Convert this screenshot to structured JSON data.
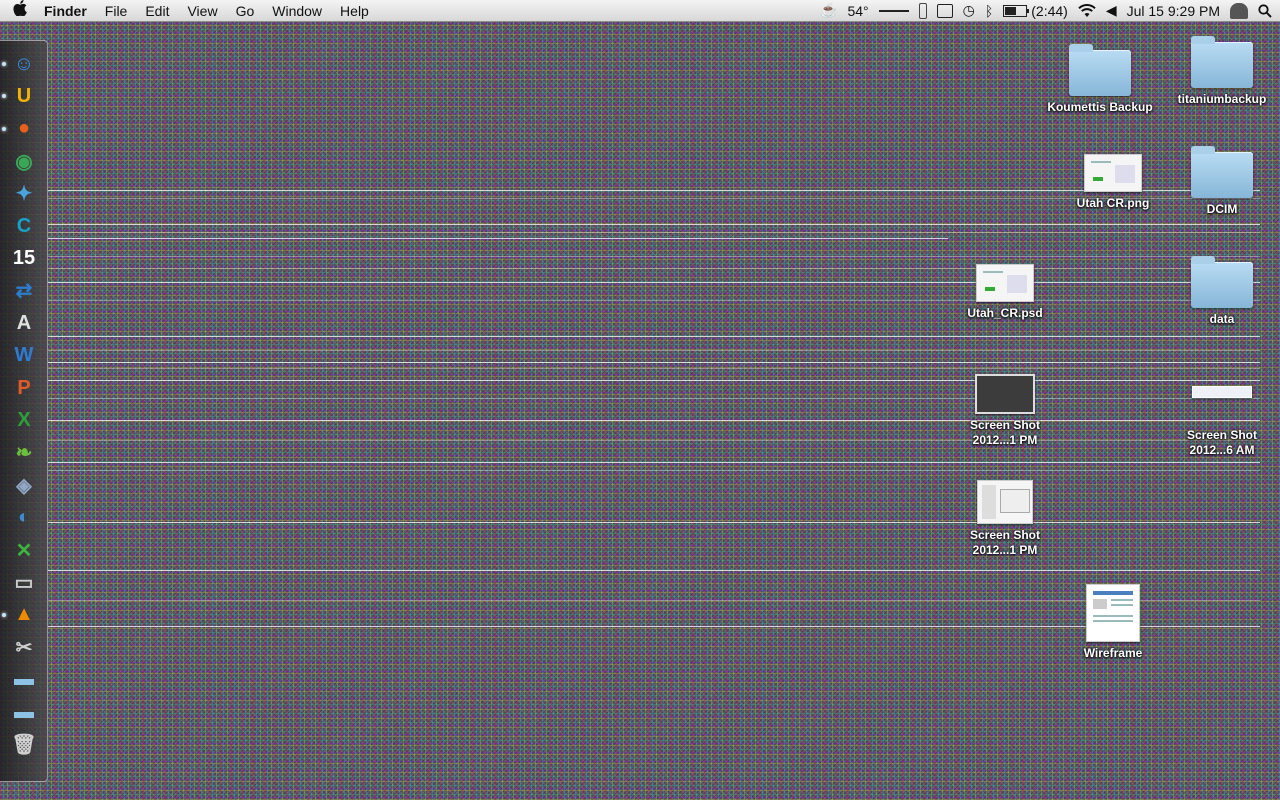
{
  "menubar": {
    "app_name": "Finder",
    "menus": [
      "File",
      "Edit",
      "View",
      "Go",
      "Window",
      "Help"
    ],
    "status": {
      "temperature": "54°",
      "battery": "(2:44)",
      "battery_level": 0.55,
      "datetime": "Jul 15  9:29 PM"
    },
    "icons": [
      "apple-icon",
      "dashboard-icon",
      "coffee-icon",
      "slider-icon",
      "display-icon",
      "time-machine-icon",
      "bluetooth-icon",
      "battery-icon",
      "wifi-icon",
      "volume-icon",
      "user-icon",
      "spotlight-icon"
    ]
  },
  "dock": {
    "items": [
      {
        "name": "finder",
        "glyph": "☺",
        "color": "#3a8ee6",
        "running": true
      },
      {
        "name": "magnet",
        "glyph": "U",
        "color": "#f2b400",
        "running": true
      },
      {
        "name": "firefox",
        "glyph": "●",
        "color": "#e8601c",
        "running": true
      },
      {
        "name": "chrome",
        "glyph": "◉",
        "color": "#3aa757",
        "running": false
      },
      {
        "name": "safari",
        "glyph": "✦",
        "color": "#4aa3df",
        "running": false
      },
      {
        "name": "cyberduck",
        "glyph": "C",
        "color": "#1aa0c8",
        "running": false
      },
      {
        "name": "calendar",
        "glyph": "15",
        "color": "#ffffff",
        "running": false
      },
      {
        "name": "sync",
        "glyph": "⇄",
        "color": "#2a7fd0",
        "running": false
      },
      {
        "name": "font-book",
        "glyph": "A",
        "color": "#e0e0e0",
        "running": false
      },
      {
        "name": "word",
        "glyph": "W",
        "color": "#2e7cd6",
        "running": false
      },
      {
        "name": "powerpoint",
        "glyph": "P",
        "color": "#e05a2a",
        "running": false
      },
      {
        "name": "excel",
        "glyph": "X",
        "color": "#2e9e3a",
        "running": false
      },
      {
        "name": "evernote",
        "glyph": "❧",
        "color": "#6abf3b",
        "running": false
      },
      {
        "name": "instruments",
        "glyph": "◈",
        "color": "#8fa7c4",
        "running": false
      },
      {
        "name": "network",
        "glyph": "◐",
        "color": "#3d8bd0",
        "running": false
      },
      {
        "name": "keepassx",
        "glyph": "✕",
        "color": "#3fb33f",
        "running": false
      },
      {
        "name": "terminal",
        "glyph": "▭",
        "color": "#cccccc",
        "running": false
      },
      {
        "name": "vlc",
        "glyph": "▲",
        "color": "#f08a00",
        "running": true
      },
      {
        "name": "utilities",
        "glyph": "✂",
        "color": "#cfcfcf",
        "running": false
      },
      {
        "name": "applications-stack",
        "glyph": "▬",
        "color": "#8ec1e6",
        "running": false
      },
      {
        "name": "documents-stack",
        "glyph": "▬",
        "color": "#8ec1e6",
        "running": false
      },
      {
        "name": "trash",
        "glyph": "🗑",
        "color": "#d0d0d0",
        "running": false
      }
    ]
  },
  "desktop": {
    "icons": [
      {
        "label": "Koumettis Backup",
        "kind": "folder"
      },
      {
        "label": "titaniumbackup",
        "kind": "folder"
      },
      {
        "label": "Utah CR.png",
        "kind": "image"
      },
      {
        "label": "DCIM",
        "kind": "folder"
      },
      {
        "label": "Utah_CR.psd",
        "kind": "image"
      },
      {
        "label": "data",
        "kind": "folder"
      },
      {
        "label": "Screen Shot 2012...1 PM",
        "kind": "screenshot-dark"
      },
      {
        "label": "Screen Shot 2012...6 AM",
        "kind": "screenshot-wide"
      },
      {
        "label": "Screen Shot 2012...1 PM",
        "kind": "screenshot-window"
      },
      {
        "label": "Wireframe",
        "kind": "document"
      }
    ]
  }
}
